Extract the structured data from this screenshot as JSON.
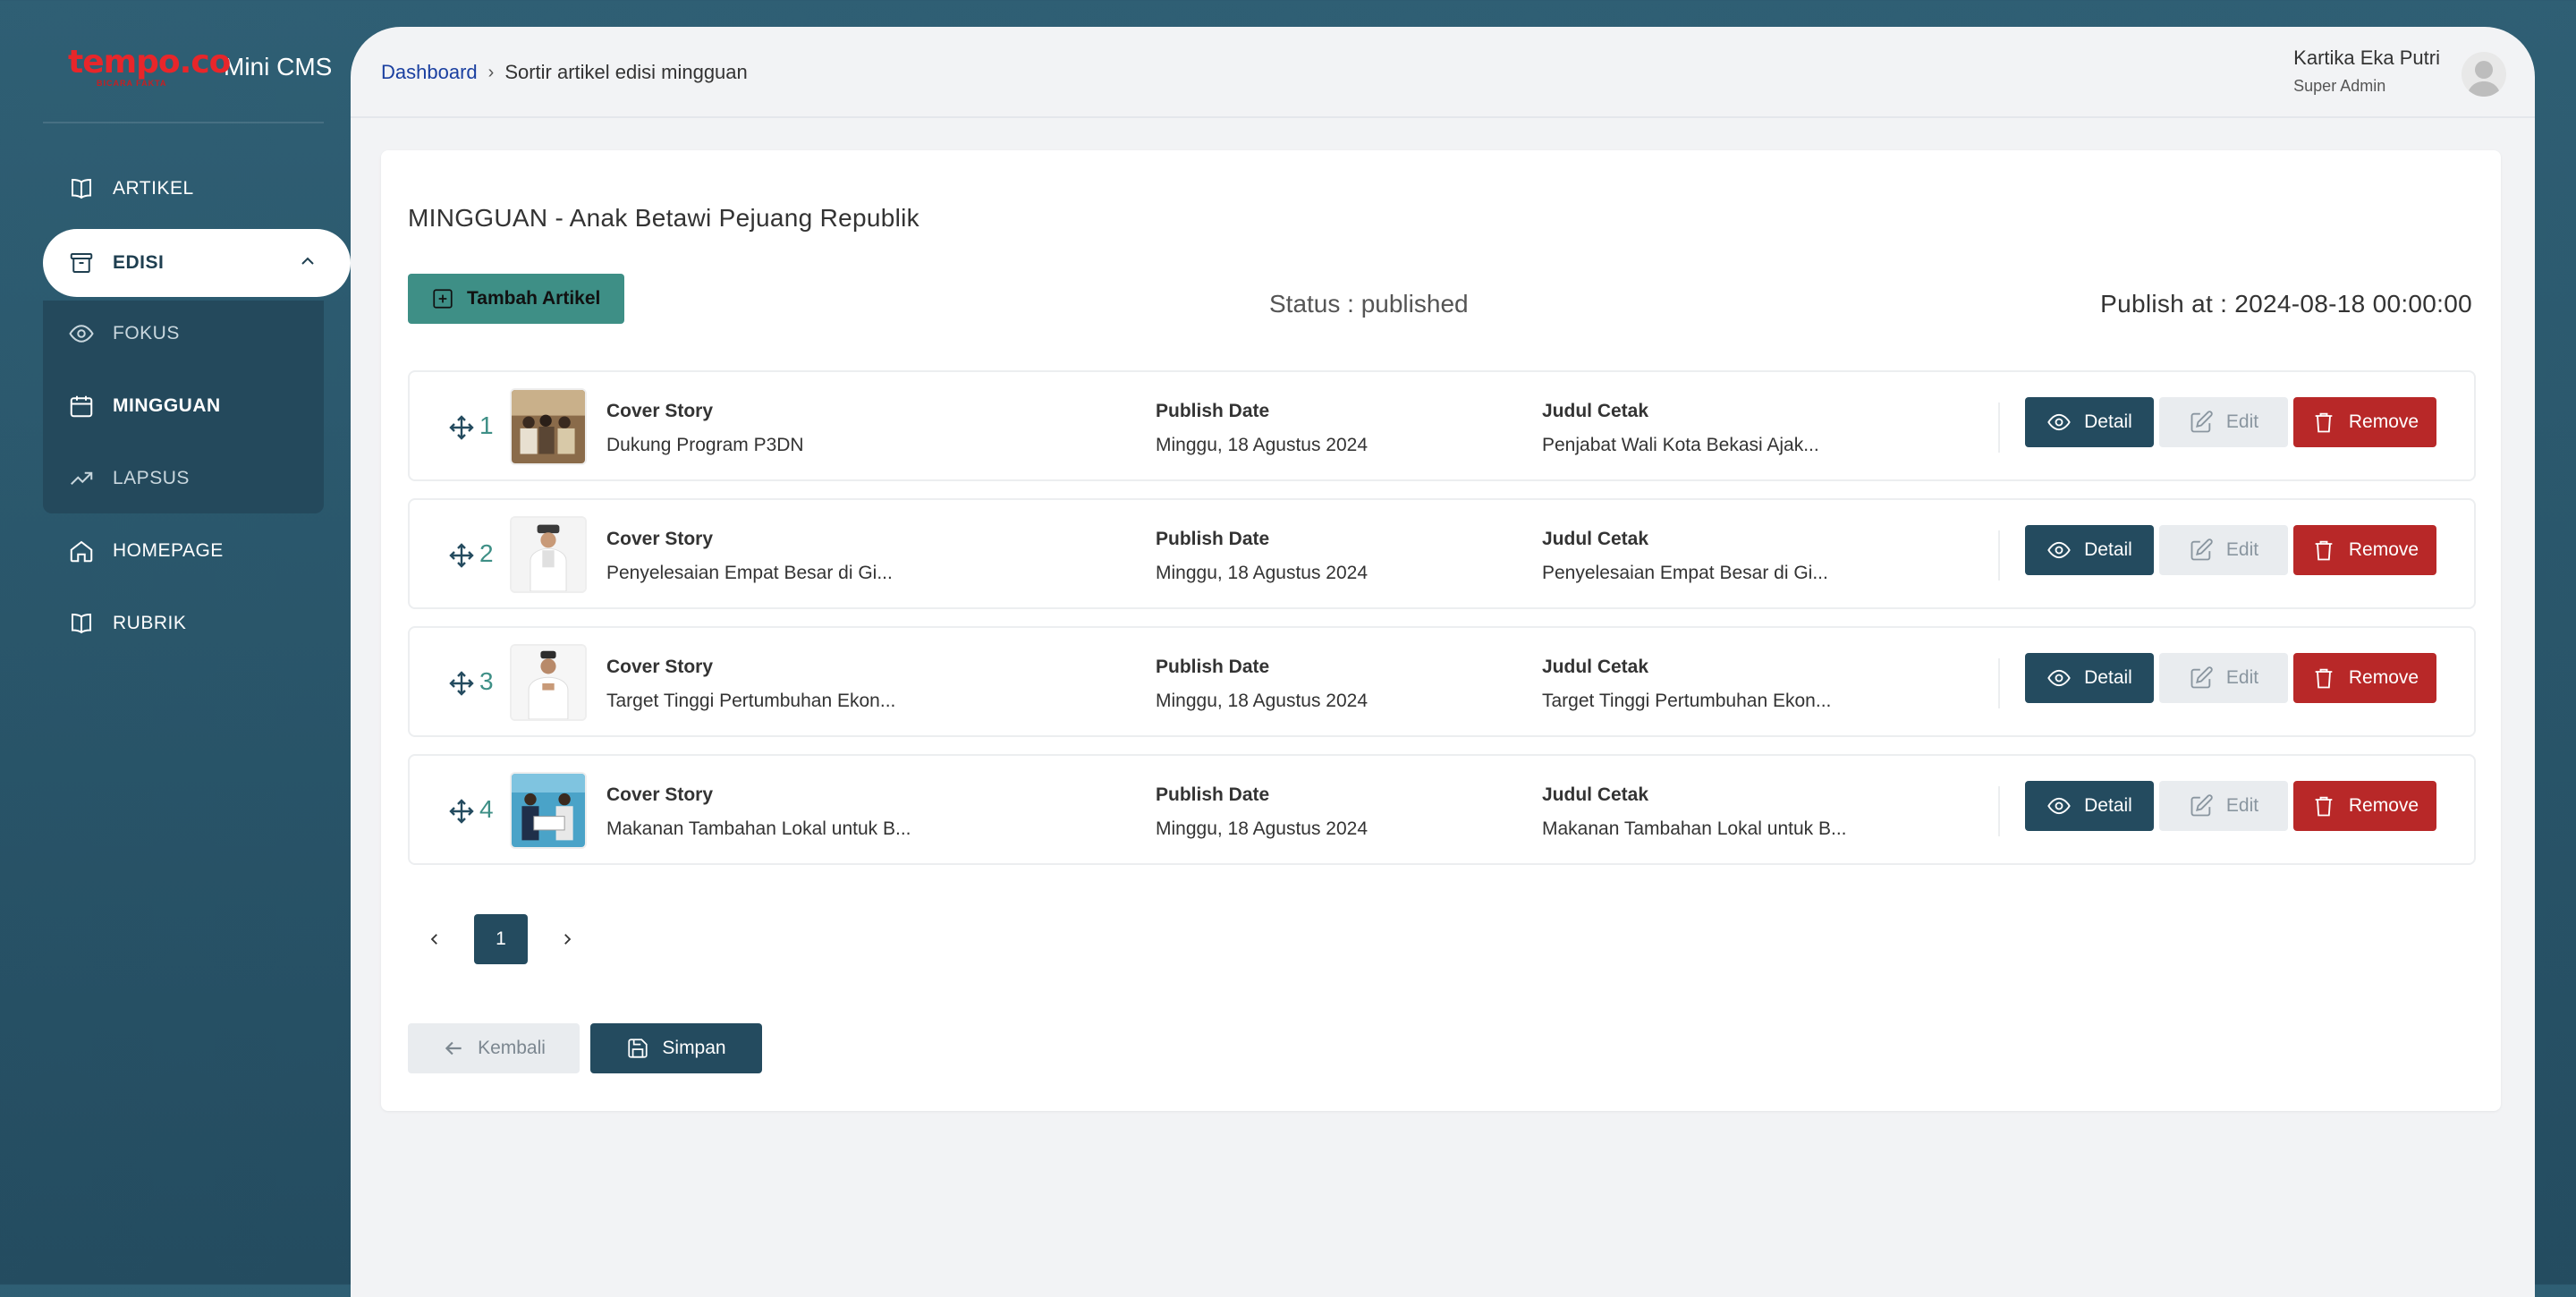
{
  "brand": {
    "logo_text": "tempo.co",
    "logo_tagline": "BICARA FAKTA",
    "app_name": "Mini CMS"
  },
  "sidebar": {
    "items": [
      {
        "label": "ARTIKEL",
        "icon": "book-icon"
      },
      {
        "label": "EDISI",
        "icon": "archive-box-icon",
        "expanded": true
      },
      {
        "label": "FOKUS",
        "icon": "eye-icon"
      },
      {
        "label": "MINGGUAN",
        "icon": "calendar-icon"
      },
      {
        "label": "LAPSUS",
        "icon": "trending-up-icon"
      },
      {
        "label": "HOMEPAGE",
        "icon": "home-icon"
      },
      {
        "label": "RUBRIK",
        "icon": "book-icon"
      }
    ]
  },
  "breadcrumb": {
    "home": "Dashboard",
    "separator": "›",
    "current": "Sortir artikel edisi mingguan"
  },
  "user": {
    "name": "Kartika Eka Putri",
    "role": "Super Admin"
  },
  "page": {
    "title": "MINGGUAN - Anak Betawi Pejuang Republik",
    "add_button": "Tambah Artikel",
    "status": "Status : published",
    "publish_at": "Publish at : 2024-08-18 00:00:00"
  },
  "columns": {
    "rubrik": "Cover Story",
    "publish_date": "Publish Date",
    "judul_cetak": "Judul Cetak"
  },
  "articles": [
    {
      "index": "1",
      "rubrik": "Cover Story",
      "title": "Dukung Program P3DN",
      "publish_date": "Minggu, 18 Agustus 2024",
      "judul_cetak": "Penjabat Wali Kota Bekasi Ajak..."
    },
    {
      "index": "2",
      "rubrik": "Cover Story",
      "title": "Penyelesaian Empat Besar di Gi...",
      "publish_date": "Minggu, 18 Agustus 2024",
      "judul_cetak": "Penyelesaian Empat Besar di Gi..."
    },
    {
      "index": "3",
      "rubrik": "Cover Story",
      "title": "Target Tinggi Pertumbuhan Ekon...",
      "publish_date": "Minggu, 18 Agustus 2024",
      "judul_cetak": "Target Tinggi Pertumbuhan Ekon..."
    },
    {
      "index": "4",
      "rubrik": "Cover Story",
      "title": "Makanan Tambahan Lokal untuk B...",
      "publish_date": "Minggu, 18 Agustus 2024",
      "judul_cetak": "Makanan Tambahan Lokal untuk B..."
    }
  ],
  "row_actions": {
    "detail": "Detail",
    "edit": "Edit",
    "remove": "Remove"
  },
  "pagination": {
    "current_page": "1"
  },
  "footer_actions": {
    "back": "Kembali",
    "save": "Simpan"
  },
  "colors": {
    "sidebar_bg": "#2a5569",
    "primary": "#244b5f",
    "accent_teal": "#3e8f86",
    "danger": "#b82828",
    "logo_red": "#e8262a"
  }
}
